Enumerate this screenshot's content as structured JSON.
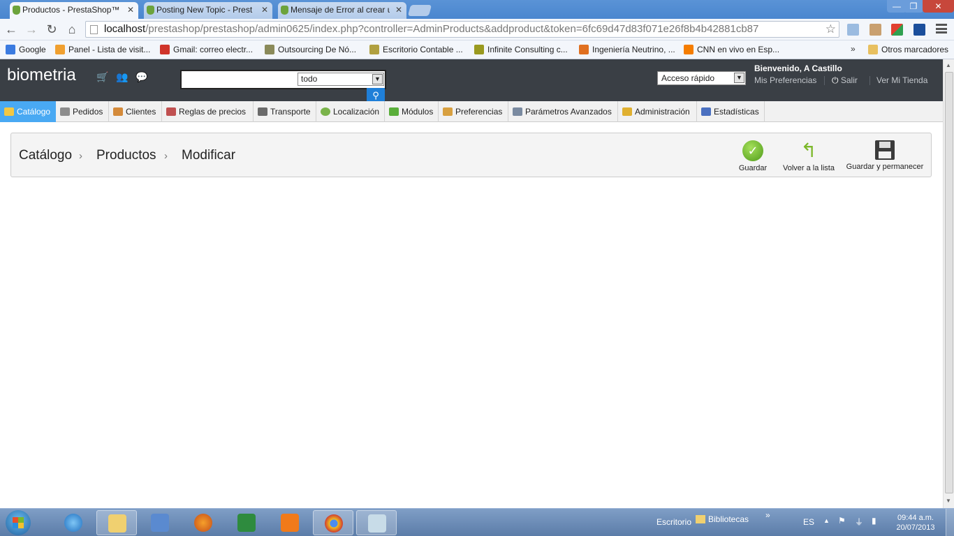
{
  "browser": {
    "tabs": [
      {
        "label": "Productos - PrestaShop™",
        "active": true
      },
      {
        "label": "Posting New Topic - Prest",
        "active": false
      },
      {
        "label": "Mensaje de Error al crear u",
        "active": false
      }
    ],
    "url_host": "localhost",
    "url_path": "/prestashop/prestashop/admin0625/index.php?controller=AdminProducts&addproduct&token=6fc69d47d83f071e26f8b4b42881cb87",
    "bookmarks": [
      {
        "label": "Google",
        "icon": "google-icon",
        "color": "#3b7be0"
      },
      {
        "label": "Panel - Lista de visit...",
        "icon": "panel-icon",
        "color": "#f0a030"
      },
      {
        "label": "Gmail: correo electr...",
        "icon": "gmail-icon",
        "color": "#d0352b"
      },
      {
        "label": "Outsourcing De Nó...",
        "icon": "outsourcing-icon",
        "color": "#8a8a5a"
      },
      {
        "label": "Escritorio Contable ...",
        "icon": "escritorio-icon",
        "color": "#b0a040"
      },
      {
        "label": "Infinite Consulting c...",
        "icon": "infinite-icon",
        "color": "#9a9a20"
      },
      {
        "label": "Ingeniería Neutrino, ...",
        "icon": "neutrino-icon",
        "color": "#e07020"
      },
      {
        "label": "CNN en vivo en Esp...",
        "icon": "blogger-icon",
        "color": "#f57d00"
      }
    ],
    "bookmarks_more": "»",
    "other_bookmarks": "Otros marcadores"
  },
  "header": {
    "shop_name": "biometria",
    "search_scope": "todo",
    "quick_access": "Acceso rápido",
    "welcome": "Bienvenido, A Castillo",
    "my_prefs": "Mis Preferencias",
    "logout": "Salir",
    "view_shop": "Ver Mi Tienda"
  },
  "menu": [
    {
      "label": "Catálogo",
      "icon": "folder-icon",
      "color": "#f2c744",
      "active": true
    },
    {
      "label": "Pedidos",
      "icon": "cart-icon",
      "color": "#8c8c8c",
      "active": false
    },
    {
      "label": "Clientes",
      "icon": "user-icon",
      "color": "#d48a3a",
      "active": false
    },
    {
      "label": "Reglas de precios",
      "icon": "price-rules-icon",
      "color": "#c05050",
      "active": false
    },
    {
      "label": "Transporte",
      "icon": "truck-icon",
      "color": "#6a6a6a",
      "active": false
    },
    {
      "label": "Localización",
      "icon": "globe-icon",
      "color": "#7ab34a",
      "active": false
    },
    {
      "label": "Módulos",
      "icon": "puzzle-icon",
      "color": "#5aae3a",
      "active": false
    },
    {
      "label": "Preferencias",
      "icon": "preferences-icon",
      "color": "#d8a040",
      "active": false
    },
    {
      "label": "Parámetros Avanzados",
      "icon": "wrench-icon",
      "color": "#7a8aa0",
      "active": false
    },
    {
      "label": "Administración",
      "icon": "key-icon",
      "color": "#e0b030",
      "active": false
    },
    {
      "label": "Estadísticas",
      "icon": "stats-icon",
      "color": "#4a70c0",
      "active": false
    }
  ],
  "breadcrumb": [
    "Catálogo",
    "Productos",
    "Modificar"
  ],
  "actions": {
    "save": "Guardar",
    "back": "Volver a la lista",
    "save_stay": "Guardar y permanecer"
  },
  "taskbar": {
    "desktop": "Escritorio",
    "libraries": "Bibliotecas",
    "language": "ES",
    "time": "09:44 a.m.",
    "date": "20/07/2013"
  }
}
